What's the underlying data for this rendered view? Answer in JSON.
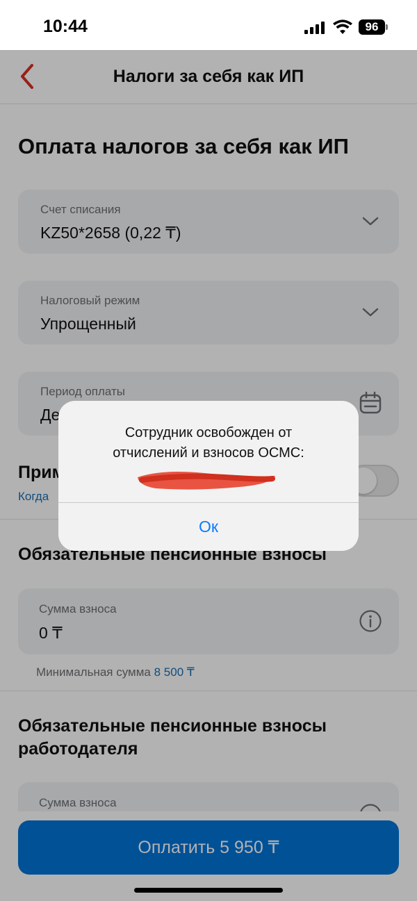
{
  "status_bar": {
    "time": "10:44",
    "battery": "96"
  },
  "nav": {
    "title": "Налоги за себя как ИП",
    "back_icon": "chevron-left-icon"
  },
  "page": {
    "title": "Оплата налогов за себя как ИП"
  },
  "fields": {
    "account": {
      "label": "Счет списания",
      "value": "KZ50*2658 (0,22 ₸)",
      "icon": "chevron-down-icon"
    },
    "tax_regime": {
      "label": "Налоговый режим",
      "value": "Упрощенный",
      "icon": "chevron-down-icon"
    },
    "period": {
      "label": "Период оплаты",
      "value": "Де",
      "icon": "calendar-icon"
    }
  },
  "toggle": {
    "title": "Прим",
    "link": "Когда"
  },
  "pension": {
    "title": "Обязательные пенсионные взносы",
    "label": "Сумма взноса",
    "value": "0 ₸",
    "icon": "info-icon",
    "hint_prefix": "Минимальная сумма",
    "hint_amount": "8 500 ₸"
  },
  "employer_pension": {
    "title_line1": "Обязательные пенсионные взносы",
    "title_line2": "работодателя",
    "label": "Сумма взноса"
  },
  "pay_button": {
    "label": "Оплатить 5 950 ₸"
  },
  "alert": {
    "line1": "Сотрудник освобожден от",
    "line2": "отчислений и взносов ОСМС:",
    "ok_label": "Ок"
  },
  "colors": {
    "accent": "#0275d8",
    "link": "#1a6fb5",
    "back_arrow": "#d93025",
    "redaction": "#e8432f"
  }
}
